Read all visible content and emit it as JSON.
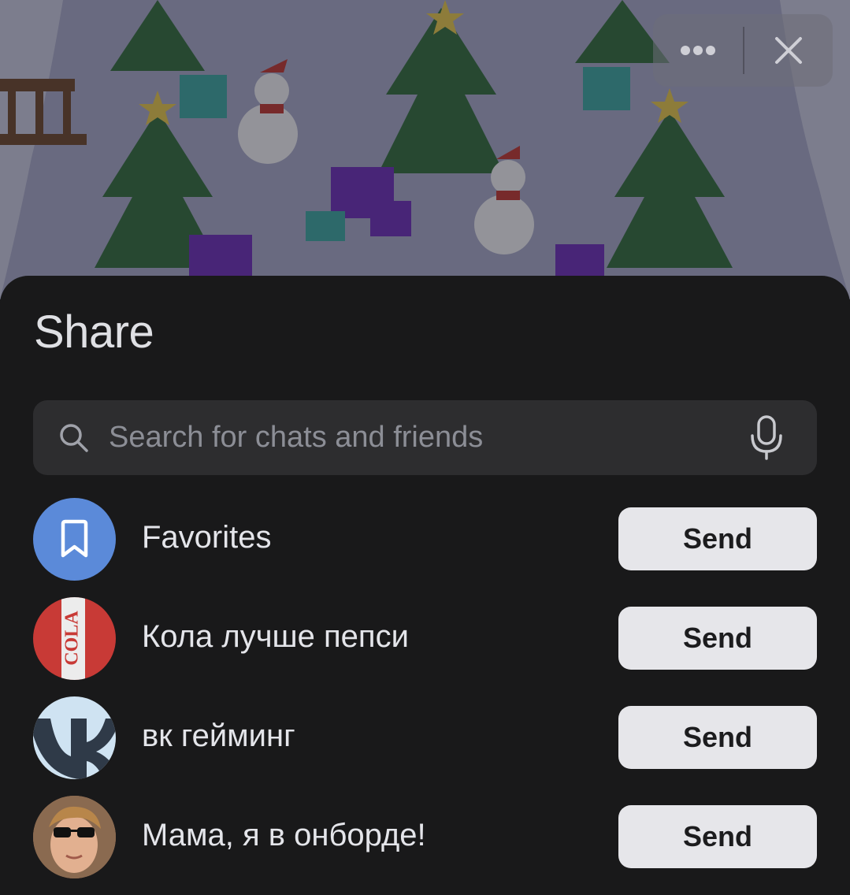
{
  "sheet": {
    "title": "Share",
    "search": {
      "placeholder": "Search for chats and friends",
      "value": ""
    }
  },
  "chats": [
    {
      "name": "Favorites",
      "send_label": "Send",
      "avatar_icon": "bookmark-icon",
      "avatar_color": "#5b8ad9"
    },
    {
      "name": "Кола лучше пепси",
      "send_label": "Send",
      "avatar_icon": "cola-logo",
      "avatar_color": "#c83a36",
      "avatar_text": "COLA"
    },
    {
      "name": "вк гейминг",
      "send_label": "Send",
      "avatar_icon": "vk-logo",
      "avatar_color": "#cfe3f2"
    },
    {
      "name": "Мама, я в онборде!",
      "send_label": "Send",
      "avatar_icon": "user-photo",
      "avatar_color": "#b07a5a"
    }
  ],
  "colors": {
    "sheet_bg": "#19191a",
    "search_bg": "#2d2d2f",
    "button_bg": "#e6e6ea",
    "scene_bg": "#8e90b0"
  }
}
